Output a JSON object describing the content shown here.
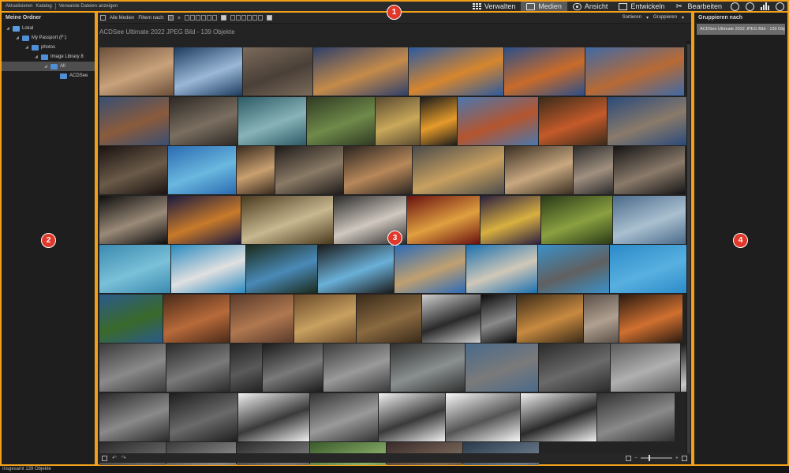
{
  "topbar": {
    "actions": [
      "Aktualisieren",
      "Katalog",
      "Verwaiste Dateien anzeigen"
    ],
    "modes": [
      {
        "label": "Verwalten",
        "icon": "grid-icon",
        "active": false
      },
      {
        "label": "Medien",
        "icon": "photo-icon",
        "active": true
      },
      {
        "label": "Ansicht",
        "icon": "eye-icon",
        "active": false
      },
      {
        "label": "Entwickeln",
        "icon": "develop-icon",
        "active": false
      },
      {
        "label": "Bearbeiten",
        "icon": "edit-icon",
        "active": false
      }
    ],
    "extra_icons": [
      "globe-icon",
      "help-icon",
      "histogram-icon",
      "eye-settings-icon"
    ]
  },
  "callouts": [
    "1",
    "2",
    "3",
    "4"
  ],
  "left_panel": {
    "title": "Meine Ordner",
    "tree": [
      {
        "label": "Lokal",
        "level": 0
      },
      {
        "label": "My Passport (F:)",
        "level": 1
      },
      {
        "label": "photos",
        "level": 2
      },
      {
        "label": "Image Library 8",
        "level": 3
      },
      {
        "label": "All",
        "level": 4,
        "selected": true
      },
      {
        "label": "ACDSee",
        "level": 5
      }
    ]
  },
  "toolbar": {
    "all_media": "Alle Medien",
    "filter_label": "Filtern nach:",
    "rating_symbol": "≥",
    "sort": "Sortieren",
    "group": "Gruppieren"
  },
  "collection_title": "ACDSee Ultimate 2022 JPEG Bild - 139 Objekte",
  "right_panel": {
    "title": "Gruppieren nach",
    "group_item": "ACDSee Ultimate 2022 JPEG Bild - 139 Obj..."
  },
  "status": "Insgesamt 139 Objekte",
  "thumb_rows": [
    [
      [
        "#6b4f3a",
        "#c9a27b"
      ],
      [
        "#1d3c5f",
        "#9bb8d8"
      ],
      [
        "#7b6a5a",
        "#4a4038"
      ],
      [
        "#2e3f6a",
        "#c58b4a"
      ],
      [
        "#2b5aa0",
        "#d6862e"
      ],
      [
        "#2a4f8a",
        "#c96b2a"
      ],
      [
        "#3e6aa6",
        "#b86a35"
      ]
    ],
    [
      [
        "#3a4f72",
        "#8a5b3c"
      ],
      [
        "#2c2824",
        "#7a6e60"
      ],
      [
        "#2c5a66",
        "#88b4b8"
      ],
      [
        "#2f3a22",
        "#6f8a4a"
      ],
      [
        "#5a4a30",
        "#c9a85a"
      ],
      [
        "#1a1a1a",
        "#e59b2a"
      ],
      [
        "#4a78b0",
        "#b4552e"
      ],
      [
        "#3a2a1a",
        "#c45a2a"
      ],
      [
        "#2a4a7a",
        "#8a7a6a"
      ]
    ],
    [
      [
        "#1a1210",
        "#6a5a48"
      ],
      [
        "#2a6ab0",
        "#6ab8e0"
      ],
      [
        "#3a2a1e",
        "#c8a070"
      ],
      [
        "#1e1a18",
        "#8a7a66"
      ],
      [
        "#2a2420",
        "#b8885a"
      ],
      [
        "#4a4a4a",
        "#c8a060"
      ],
      [
        "#3a2e22",
        "#c8a880"
      ],
      [
        "#2a2a2a",
        "#a09080"
      ],
      [
        "#141414",
        "#8a7a6a"
      ]
    ],
    [
      [
        "#0e0e0e",
        "#9a8a78"
      ],
      [
        "#1a1a40",
        "#c87a2a"
      ],
      [
        "#4a3a1e",
        "#c8b890"
      ],
      [
        "#2a2a2a",
        "#d0c8c0"
      ],
      [
        "#6a1010",
        "#e0a040"
      ],
      [
        "#2a1e40",
        "#d8b040"
      ],
      [
        "#2a3a18",
        "#8aa040"
      ],
      [
        "#4a6a8a",
        "#aac0d0"
      ]
    ],
    [
      [
        "#3a8ab0",
        "#7ac0d8"
      ],
      [
        "#2a8ac0",
        "#e0e0e0"
      ],
      [
        "#1a2a1a",
        "#4a8ab8"
      ],
      [
        "#1a1a1a",
        "#6ab0d8"
      ],
      [
        "#2a6ab8",
        "#c0a070"
      ],
      [
        "#1a70b0",
        "#d0c8b8"
      ],
      [
        "#3a90c8",
        "#606060"
      ],
      [
        "#2a8ac8",
        "#58b0e0"
      ]
    ],
    [
      [
        "#2a5a8a",
        "#3a6a2a"
      ],
      [
        "#4a2a1a",
        "#b86a3a"
      ],
      [
        "#5a3a2a",
        "#b07850"
      ],
      [
        "#6a4a2a",
        "#c8a060"
      ],
      [
        "#3a2a1a",
        "#8a6a40"
      ],
      [
        "#d0d0d0",
        "#2a2a2a"
      ],
      [
        "#0a0a0a",
        "#8a8a8a"
      ],
      [
        "#3a2a18",
        "#c88a40"
      ],
      [
        "#5a5048",
        "#b0a090"
      ],
      [
        "#2a1a10",
        "#d07030"
      ]
    ],
    [
      [
        "#3a3a3a",
        "#8a8a8a"
      ],
      [
        "#2a2a2a",
        "#7a7a7a"
      ],
      [
        "#222222",
        "#5a5a5a"
      ],
      [
        "#1a1a1a",
        "#7a7a7a"
      ],
      [
        "#3a3a3a",
        "#9a9a9a"
      ],
      [
        "#303030",
        "#8a9090"
      ],
      [
        "#4a6a8a",
        "#7a7a7a"
      ],
      [
        "#2a2a2a",
        "#6a6a6a"
      ],
      [
        "#5a5a5a",
        "#b0b0b0"
      ],
      [
        "#1a1a1a",
        "#c8c8c8"
      ]
    ],
    [
      [
        "#2a2a2a",
        "#8a8a8a"
      ],
      [
        "#1e1e1e",
        "#6a6a6a"
      ],
      [
        "#f0f0f0",
        "#3a3a3a"
      ],
      [
        "#333333",
        "#9a9a9a"
      ],
      [
        "#f0f0f0",
        "#3a3a3a"
      ],
      [
        "#f8f8f8",
        "#555555"
      ],
      [
        "#f0f0f0",
        "#2a2a2a"
      ],
      [
        "#303030",
        "#8a8a8a"
      ]
    ],
    [
      [
        "#2a2a2a",
        "#6a6a6a"
      ],
      [
        "#3a3a3a",
        "#8a8a8a"
      ],
      [
        "#2a2a2a",
        "#7a7a7a"
      ],
      [
        "#3a5a2a",
        "#8ab06a"
      ],
      [
        "#3a2a2a",
        "#7a6a5a"
      ],
      [
        "#2a3a4a",
        "#6a7a8a"
      ]
    ]
  ],
  "thumb_widths": [
    [
      94,
      86,
      88,
      120,
      120,
      102,
      125
    ],
    [
      88,
      86,
      86,
      86,
      56,
      46,
      102,
      86,
      100
    ],
    [
      86,
      86,
      48,
      86,
      86,
      116,
      86,
      50,
      90
    ],
    [
      86,
      92,
      116,
      92,
      92,
      76,
      90,
      92
    ],
    [
      90,
      94,
      90,
      96,
      90,
      90,
      90,
      100
    ],
    [
      80,
      84,
      80,
      78,
      82,
      74,
      44,
      84,
      44,
      80
    ],
    [
      84,
      80,
      40,
      76,
      84,
      94,
      92,
      90,
      88,
      100
    ],
    [
      88,
      86,
      90,
      86,
      84,
      94,
      96,
      98
    ],
    [
      84,
      88,
      92,
      96,
      96,
      96
    ]
  ]
}
